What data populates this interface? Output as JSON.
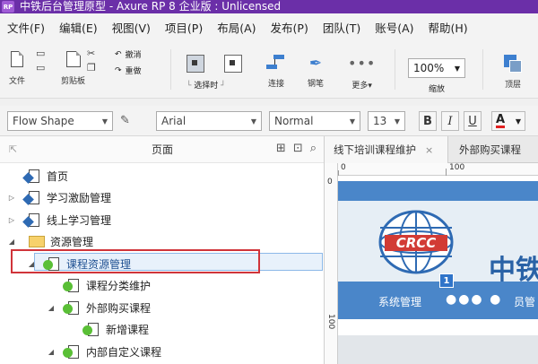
{
  "window": {
    "app_badge": "RP",
    "title": "中铁后台管理原型 - Axure RP 8 企业版 : Unlicensed"
  },
  "menu": [
    "文件(F)",
    "编辑(E)",
    "视图(V)",
    "项目(P)",
    "布局(A)",
    "发布(P)",
    "团队(T)",
    "账号(A)",
    "帮助(H)"
  ],
  "toolbar": {
    "file_label": "文件",
    "clipboard_label": "剪贴板",
    "undo_label": "撤消",
    "redo_label": "重做",
    "select_label": "选择时",
    "connect_label": "连接",
    "pen_label": "钢笔",
    "more_label": "更多",
    "more_caret": "▾",
    "zoom_value": "100%",
    "zoom_label": "缩放",
    "top_layer_label": "顶层"
  },
  "stylebar": {
    "shape_style": "Flow Shape",
    "font_family": "Arial",
    "font_style": "Normal",
    "font_size": "13",
    "bold": "B",
    "italic": "I",
    "underline": "U",
    "font_color": "A",
    "font_color_value": "#e02020"
  },
  "pages_panel": {
    "title": "页面",
    "tree": [
      {
        "label": "首页",
        "type": "page",
        "badge": "home",
        "expander": "",
        "indent": 0
      },
      {
        "label": "学习激励管理",
        "type": "page",
        "badge": "home",
        "expander": "▷",
        "indent": 0
      },
      {
        "label": "线上学习管理",
        "type": "page",
        "badge": "home",
        "expander": "▷",
        "indent": 0
      },
      {
        "label": "资源管理",
        "type": "folder",
        "badge": "",
        "expander": "◢",
        "indent": 0
      },
      {
        "label": "课程资源管理",
        "type": "page",
        "badge": "green",
        "expander": "◢",
        "indent": 1,
        "selected": true
      },
      {
        "label": "课程分类维护",
        "type": "page",
        "badge": "green",
        "expander": "",
        "indent": 2
      },
      {
        "label": "外部购买课程",
        "type": "page",
        "badge": "green",
        "expander": "◢",
        "indent": 2
      },
      {
        "label": "新增课程",
        "type": "page",
        "badge": "green",
        "expander": "",
        "indent": 3
      },
      {
        "label": "内部自定义课程",
        "type": "page",
        "badge": "green",
        "expander": "◢",
        "indent": 2
      }
    ]
  },
  "canvas": {
    "tabs": [
      {
        "label": "线下培训课程维护",
        "close": "×",
        "active": true
      },
      {
        "label": "外部购买课程",
        "close": "",
        "active": false
      }
    ],
    "ruler_h_labels": [
      "0",
      "100"
    ],
    "ruler_v_labels": [
      "0",
      "100"
    ],
    "logo_text": "CRCC",
    "brand_text": "中铁",
    "widget_number": "1",
    "nav_text": "系统管理",
    "nav_partial": "员管"
  },
  "colors": {
    "title_bar": "#6b2fa8",
    "highlight": "#d0343a",
    "canvas_blue": "#4a86c9",
    "logo_red": "#d23b35",
    "logo_blue": "#2e6ab3"
  }
}
